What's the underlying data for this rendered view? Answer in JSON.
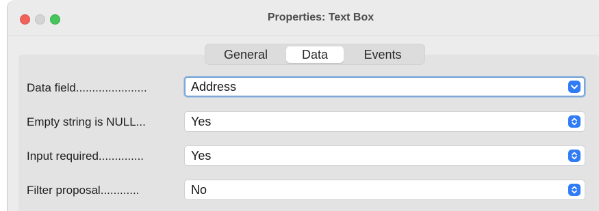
{
  "window": {
    "title": "Properties: Text Box"
  },
  "tabs": [
    {
      "label": "General",
      "selected": false
    },
    {
      "label": "Data",
      "selected": true
    },
    {
      "label": "Events",
      "selected": false
    }
  ],
  "rows": [
    {
      "label": "Data field......................",
      "value": "Address",
      "control": "dropdown",
      "focused": true
    },
    {
      "label": "Empty string is NULL...",
      "value": "Yes",
      "control": "select",
      "focused": false
    },
    {
      "label": "Input required..............",
      "value": "Yes",
      "control": "select",
      "focused": false
    },
    {
      "label": "Filter proposal............",
      "value": "No",
      "control": "select",
      "focused": false
    }
  ],
  "icons": {
    "dropdown": "chevron-down-icon",
    "select": "up-down-chevron-icon"
  },
  "colors": {
    "accent": "#2f7cf6",
    "close": "#f0625a",
    "zoom": "#45c55a",
    "focus_ring": "#7fa7d6"
  }
}
